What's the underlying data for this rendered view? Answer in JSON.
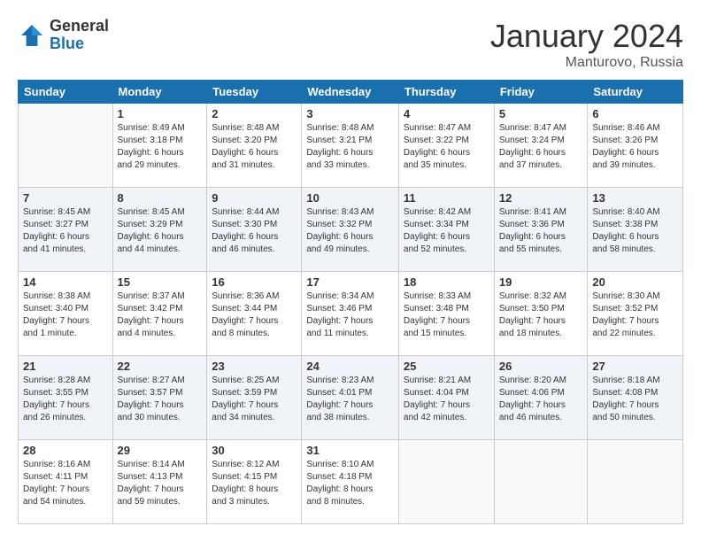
{
  "logo": {
    "general": "General",
    "blue": "Blue"
  },
  "header": {
    "month": "January 2024",
    "location": "Manturovo, Russia"
  },
  "weekdays": [
    "Sunday",
    "Monday",
    "Tuesday",
    "Wednesday",
    "Thursday",
    "Friday",
    "Saturday"
  ],
  "weeks": [
    [
      {
        "num": "",
        "info": ""
      },
      {
        "num": "1",
        "info": "Sunrise: 8:49 AM\nSunset: 3:18 PM\nDaylight: 6 hours\nand 29 minutes."
      },
      {
        "num": "2",
        "info": "Sunrise: 8:48 AM\nSunset: 3:20 PM\nDaylight: 6 hours\nand 31 minutes."
      },
      {
        "num": "3",
        "info": "Sunrise: 8:48 AM\nSunset: 3:21 PM\nDaylight: 6 hours\nand 33 minutes."
      },
      {
        "num": "4",
        "info": "Sunrise: 8:47 AM\nSunset: 3:22 PM\nDaylight: 6 hours\nand 35 minutes."
      },
      {
        "num": "5",
        "info": "Sunrise: 8:47 AM\nSunset: 3:24 PM\nDaylight: 6 hours\nand 37 minutes."
      },
      {
        "num": "6",
        "info": "Sunrise: 8:46 AM\nSunset: 3:26 PM\nDaylight: 6 hours\nand 39 minutes."
      }
    ],
    [
      {
        "num": "7",
        "info": "Sunrise: 8:45 AM\nSunset: 3:27 PM\nDaylight: 6 hours\nand 41 minutes."
      },
      {
        "num": "8",
        "info": "Sunrise: 8:45 AM\nSunset: 3:29 PM\nDaylight: 6 hours\nand 44 minutes."
      },
      {
        "num": "9",
        "info": "Sunrise: 8:44 AM\nSunset: 3:30 PM\nDaylight: 6 hours\nand 46 minutes."
      },
      {
        "num": "10",
        "info": "Sunrise: 8:43 AM\nSunset: 3:32 PM\nDaylight: 6 hours\nand 49 minutes."
      },
      {
        "num": "11",
        "info": "Sunrise: 8:42 AM\nSunset: 3:34 PM\nDaylight: 6 hours\nand 52 minutes."
      },
      {
        "num": "12",
        "info": "Sunrise: 8:41 AM\nSunset: 3:36 PM\nDaylight: 6 hours\nand 55 minutes."
      },
      {
        "num": "13",
        "info": "Sunrise: 8:40 AM\nSunset: 3:38 PM\nDaylight: 6 hours\nand 58 minutes."
      }
    ],
    [
      {
        "num": "14",
        "info": "Sunrise: 8:38 AM\nSunset: 3:40 PM\nDaylight: 7 hours\nand 1 minute."
      },
      {
        "num": "15",
        "info": "Sunrise: 8:37 AM\nSunset: 3:42 PM\nDaylight: 7 hours\nand 4 minutes."
      },
      {
        "num": "16",
        "info": "Sunrise: 8:36 AM\nSunset: 3:44 PM\nDaylight: 7 hours\nand 8 minutes."
      },
      {
        "num": "17",
        "info": "Sunrise: 8:34 AM\nSunset: 3:46 PM\nDaylight: 7 hours\nand 11 minutes."
      },
      {
        "num": "18",
        "info": "Sunrise: 8:33 AM\nSunset: 3:48 PM\nDaylight: 7 hours\nand 15 minutes."
      },
      {
        "num": "19",
        "info": "Sunrise: 8:32 AM\nSunset: 3:50 PM\nDaylight: 7 hours\nand 18 minutes."
      },
      {
        "num": "20",
        "info": "Sunrise: 8:30 AM\nSunset: 3:52 PM\nDaylight: 7 hours\nand 22 minutes."
      }
    ],
    [
      {
        "num": "21",
        "info": "Sunrise: 8:28 AM\nSunset: 3:55 PM\nDaylight: 7 hours\nand 26 minutes."
      },
      {
        "num": "22",
        "info": "Sunrise: 8:27 AM\nSunset: 3:57 PM\nDaylight: 7 hours\nand 30 minutes."
      },
      {
        "num": "23",
        "info": "Sunrise: 8:25 AM\nSunset: 3:59 PM\nDaylight: 7 hours\nand 34 minutes."
      },
      {
        "num": "24",
        "info": "Sunrise: 8:23 AM\nSunset: 4:01 PM\nDaylight: 7 hours\nand 38 minutes."
      },
      {
        "num": "25",
        "info": "Sunrise: 8:21 AM\nSunset: 4:04 PM\nDaylight: 7 hours\nand 42 minutes."
      },
      {
        "num": "26",
        "info": "Sunrise: 8:20 AM\nSunset: 4:06 PM\nDaylight: 7 hours\nand 46 minutes."
      },
      {
        "num": "27",
        "info": "Sunrise: 8:18 AM\nSunset: 4:08 PM\nDaylight: 7 hours\nand 50 minutes."
      }
    ],
    [
      {
        "num": "28",
        "info": "Sunrise: 8:16 AM\nSunset: 4:11 PM\nDaylight: 7 hours\nand 54 minutes."
      },
      {
        "num": "29",
        "info": "Sunrise: 8:14 AM\nSunset: 4:13 PM\nDaylight: 7 hours\nand 59 minutes."
      },
      {
        "num": "30",
        "info": "Sunrise: 8:12 AM\nSunset: 4:15 PM\nDaylight: 8 hours\nand 3 minutes."
      },
      {
        "num": "31",
        "info": "Sunrise: 8:10 AM\nSunset: 4:18 PM\nDaylight: 8 hours\nand 8 minutes."
      },
      {
        "num": "",
        "info": ""
      },
      {
        "num": "",
        "info": ""
      },
      {
        "num": "",
        "info": ""
      }
    ]
  ]
}
